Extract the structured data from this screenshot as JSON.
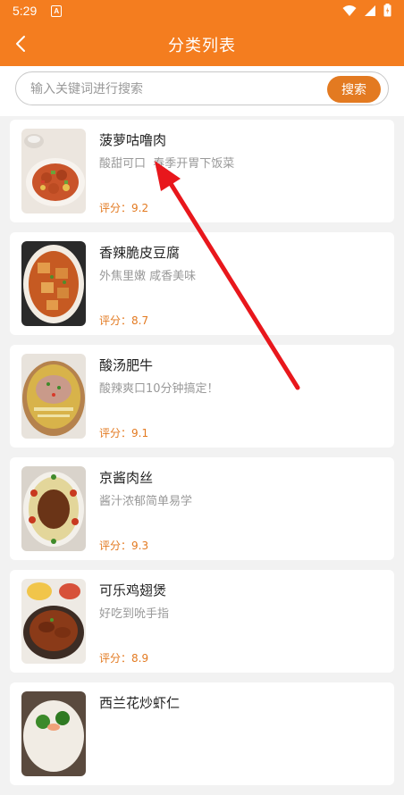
{
  "status": {
    "time": "5:29",
    "notif_letter": "A"
  },
  "appbar": {
    "title": "分类列表"
  },
  "search": {
    "placeholder": "输入关键词进行搜索",
    "value": "",
    "button": "搜索"
  },
  "recipes": [
    {
      "name": "菠萝咕噜肉",
      "desc": "酸甜可口  春季开胃下饭菜",
      "rating": "评分：9.2"
    },
    {
      "name": "香辣脆皮豆腐",
      "desc": "外焦里嫩 咸香美味",
      "rating": "评分：8.7"
    },
    {
      "name": "酸汤肥牛",
      "desc": "酸辣爽口10分钟搞定！",
      "rating": "评分：9.1"
    },
    {
      "name": "京酱肉丝",
      "desc": "酱汁浓郁简单易学",
      "rating": "评分：9.3"
    },
    {
      "name": "可乐鸡翅煲",
      "desc": "好吃到吮手指",
      "rating": "评分：8.9"
    },
    {
      "name": "西兰花炒虾仁",
      "desc": "",
      "rating": ""
    }
  ],
  "colors": {
    "accent": "#f47d1f",
    "button": "#e37a21",
    "arrow": "#e8171c"
  },
  "icons": [
    "back-arrow-icon",
    "wifi-icon",
    "signal-icon",
    "battery-icon",
    "notification-a-icon"
  ]
}
